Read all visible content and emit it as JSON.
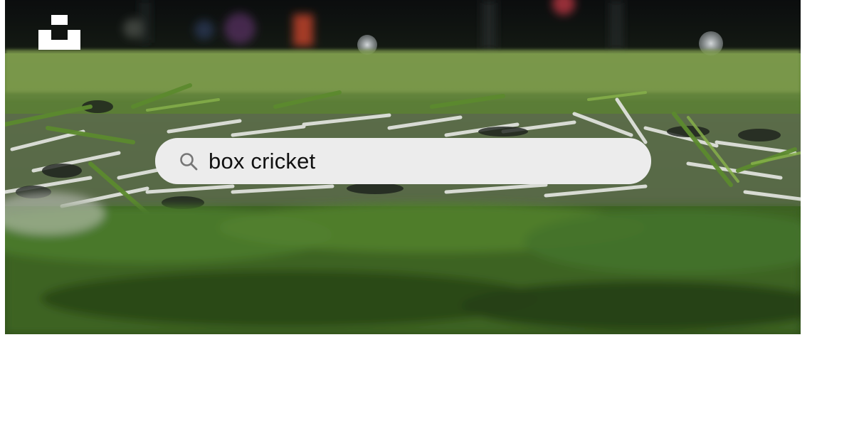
{
  "hero": {
    "logo_icon": "unsplash-logo-icon"
  },
  "search": {
    "icon": "search-icon",
    "value": "box cricket"
  },
  "colors": {
    "grass_dark": "#26401a",
    "grass_mid": "#4f7a2c",
    "grass_light": "#8fb25a",
    "fiber_white": "#d9dcd6",
    "search_bg": "#ececec",
    "text": "#111111"
  }
}
